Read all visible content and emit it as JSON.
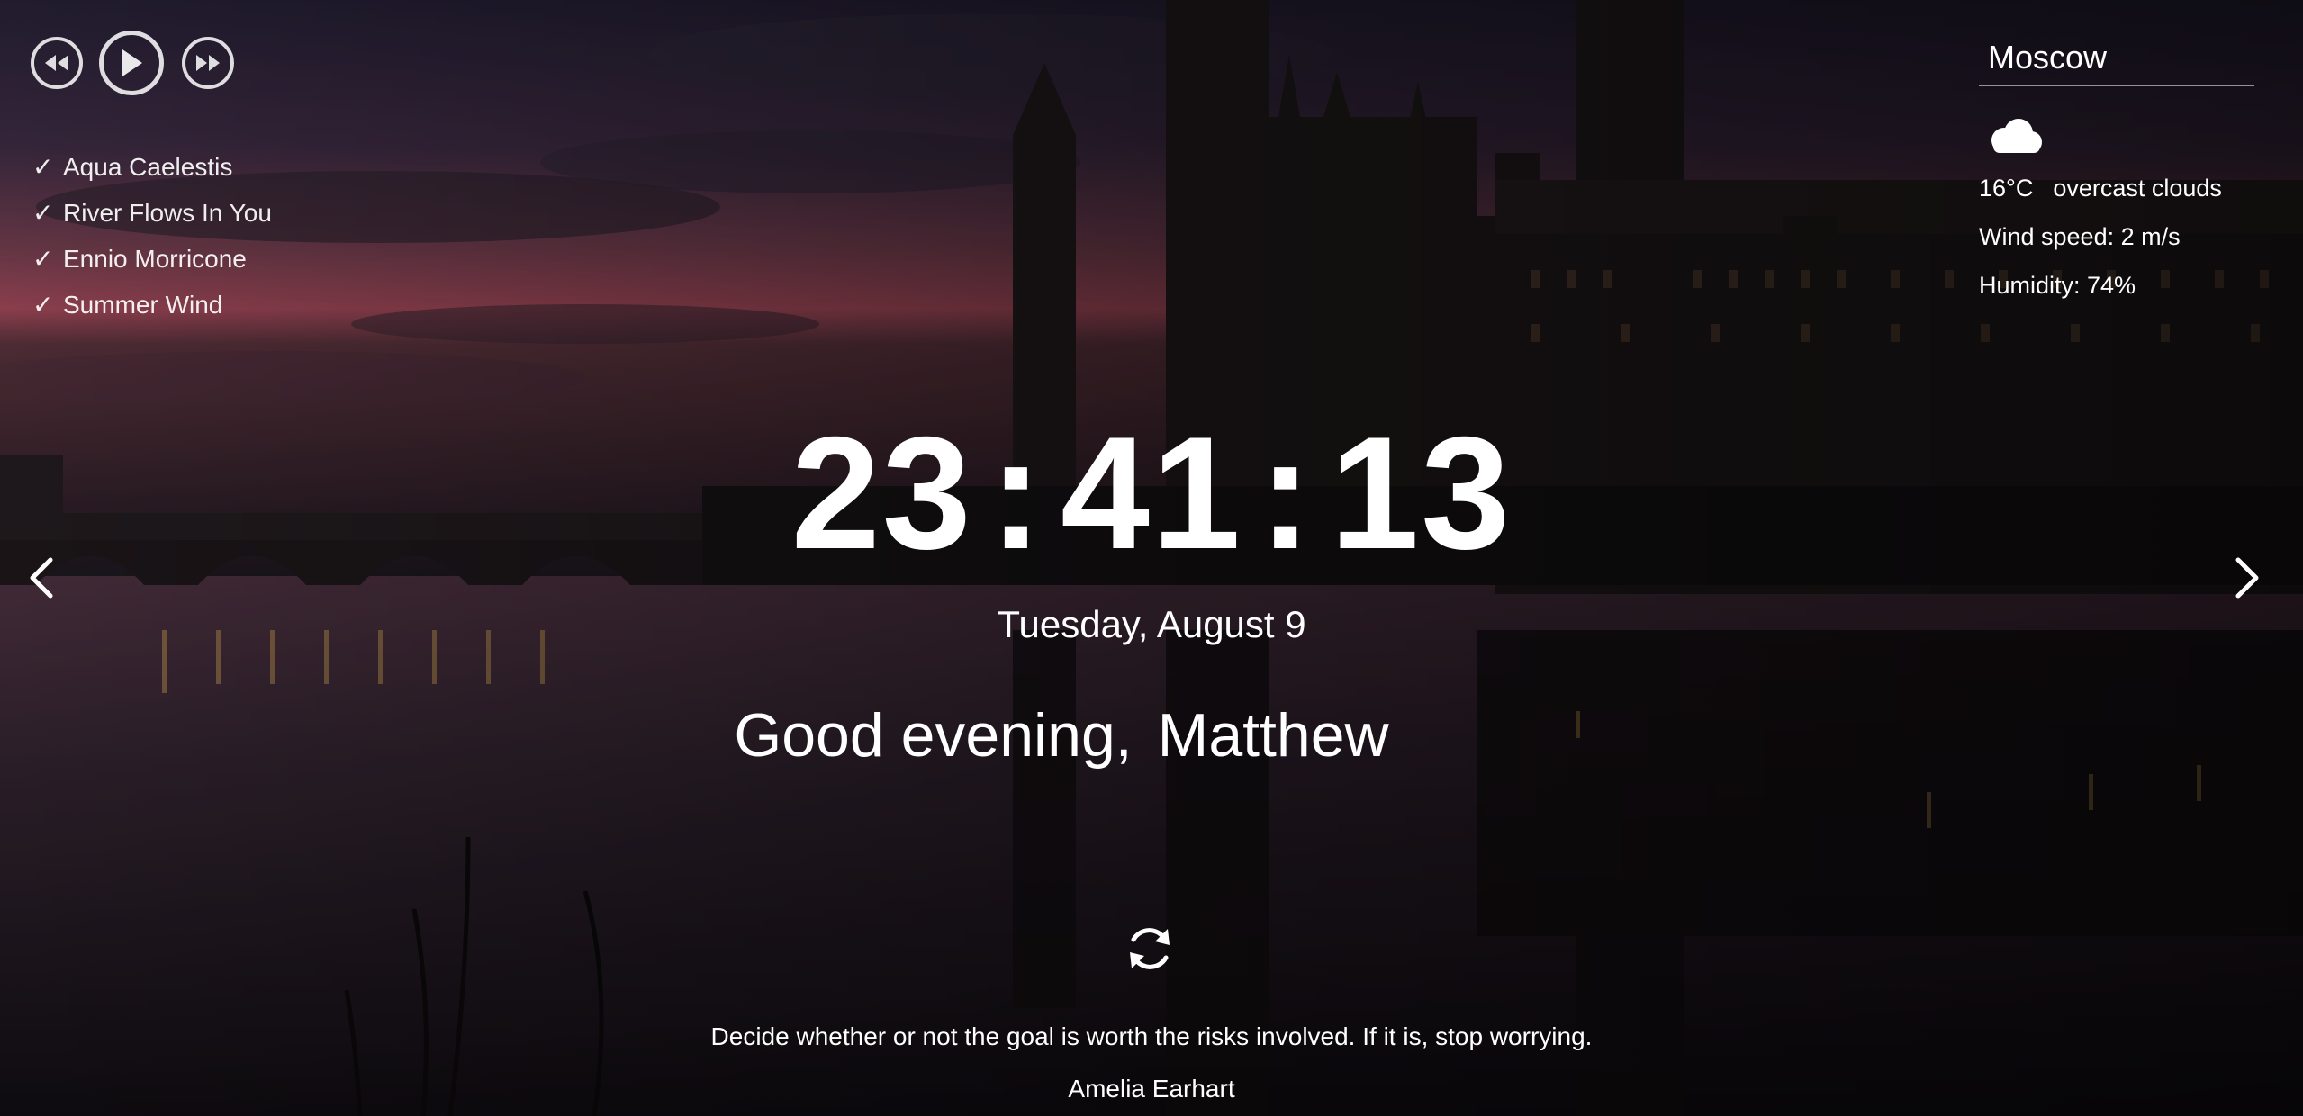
{
  "player": {
    "controls": [
      {
        "name": "rewind",
        "icon": "rewind-icon"
      },
      {
        "name": "play",
        "icon": "play-icon"
      },
      {
        "name": "fast-forward",
        "icon": "fast-forward-icon"
      }
    ]
  },
  "playlist": {
    "check_icon": "✓",
    "items": [
      {
        "title": "Aqua Caelestis"
      },
      {
        "title": "River Flows In You"
      },
      {
        "title": "Ennio Morricone"
      },
      {
        "title": "Summer Wind"
      }
    ]
  },
  "weather": {
    "city": "Moscow",
    "icon": "cloud-icon",
    "temperature": "16°C",
    "description": "overcast clouds",
    "wind": "Wind speed: 2 m/s",
    "humidity": "Humidity: 74%"
  },
  "clock": {
    "hours": "23",
    "separator": ":",
    "minutes": "41",
    "seconds": "13"
  },
  "date": "Tuesday, August 9",
  "greeting": {
    "text": "Good evening,",
    "name": "Matthew"
  },
  "slider": {
    "prev_icon": "chevron-left-icon",
    "next_icon": "chevron-right-icon"
  },
  "quote": {
    "refresh_icon": "refresh-icon",
    "text": "Decide whether or not the goal is worth the risks involved. If it is, stop worrying.",
    "author": "Amelia Earhart"
  },
  "colors": {
    "text": "#ffffff",
    "sky_top": "#2a2438",
    "sky_glow": "#c0566a",
    "water": "#2b2230"
  }
}
